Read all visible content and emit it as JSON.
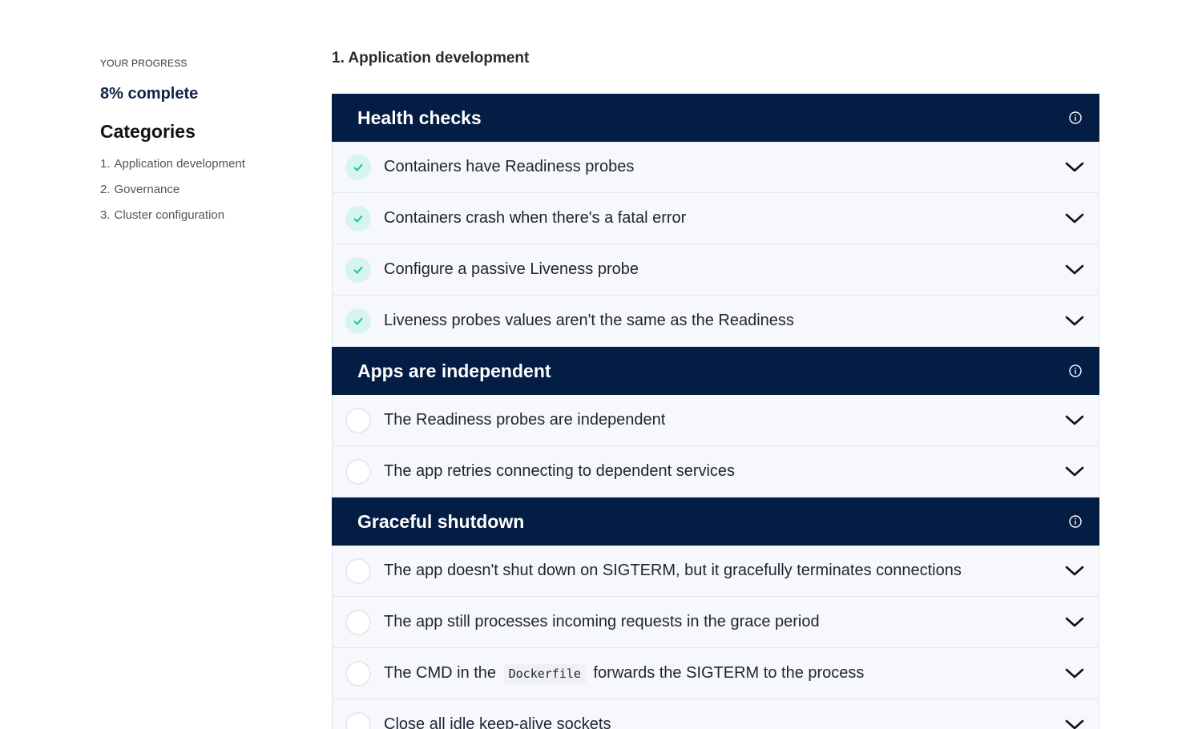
{
  "sidebar": {
    "progress_label": "YOUR PROGRESS",
    "progress_value": "8% complete",
    "categories_title": "Categories",
    "categories": [
      {
        "num": "1.",
        "label": "Application development"
      },
      {
        "num": "2.",
        "label": "Governance"
      },
      {
        "num": "3.",
        "label": "Cluster configuration"
      }
    ]
  },
  "main": {
    "section_title": "1. Application development",
    "groups": [
      {
        "title": "Health checks",
        "items": [
          {
            "text": "Containers have Readiness probes",
            "done": true
          },
          {
            "text": "Containers crash when there's a fatal error",
            "done": true
          },
          {
            "text": "Configure a passive Liveness probe",
            "done": true
          },
          {
            "text": "Liveness probes values aren't the same as the Readiness",
            "done": true
          }
        ]
      },
      {
        "title": "Apps are independent",
        "items": [
          {
            "text": "The Readiness probes are independent",
            "done": false
          },
          {
            "text": "The app retries connecting to dependent services",
            "done": false
          }
        ]
      },
      {
        "title": "Graceful shutdown",
        "items": [
          {
            "text": "The app doesn't shut down on SIGTERM, but it gracefully terminates connections",
            "done": false
          },
          {
            "text": "The app still processes incoming requests in the grace period",
            "done": false
          },
          {
            "text_before": "The CMD in the",
            "code": "Dockerfile",
            "text_after": "forwards the SIGTERM to the process",
            "done": false
          },
          {
            "text": "Close all idle keep-alive sockets",
            "done": false
          }
        ]
      }
    ]
  },
  "colors": {
    "header_bg": "#031d45",
    "check_done_bg": "#d7f5ee",
    "check_mark": "#1fc7a0",
    "row_bg": "#f6f8fb"
  },
  "icons": {
    "info": "info-circle-icon",
    "chevron": "chevron-down-icon",
    "check": "check-icon"
  }
}
